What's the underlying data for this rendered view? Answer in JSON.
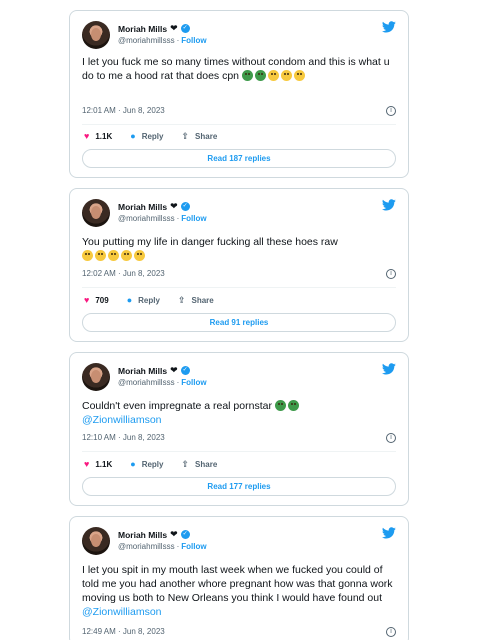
{
  "account": {
    "name": "Moriah Mills",
    "name_emoji": "❤",
    "handle": "@moriahmillsss",
    "follow_label": "Follow",
    "dot": "·"
  },
  "icons": {
    "brand": "twitter-bird-icon",
    "verified": "verified-badge-icon",
    "info": "info-icon",
    "like": "heart-icon",
    "reply": "speech-bubble-icon",
    "share": "share-upload-icon"
  },
  "colors": {
    "accent": "#1d9bf0",
    "like": "#f91880",
    "muted": "#536471",
    "border": "#cfd9de"
  },
  "action_labels": {
    "reply": "Reply",
    "share": "Share"
  },
  "tweets": [
    {
      "text_a": "I let you fuck me so many times without condom and this is what u do to me a hood rat that does cpn",
      "time": "12:01 AM · Jun 8, 2023",
      "likes": "1.1K",
      "read_replies": "Read 187 replies"
    },
    {
      "text_a": "You putting my life in danger fucking all these hoes raw",
      "time": "12:02 AM · Jun 8, 2023",
      "likes": "709",
      "read_replies": "Read 91 replies"
    },
    {
      "text_a": "Couldn't even impregnate a real pornstar",
      "mention": "@Zionwilliamson",
      "time": "12:10 AM · Jun 8, 2023",
      "likes": "1.1K",
      "read_replies": "Read 177 replies"
    },
    {
      "text_a": "I let you spit in my mouth last week when we fucked you could of told me you had another whore pregnant how was that gonna work moving us both to New Orleans you think I would have found out",
      "mention": "@Zionwilliamson",
      "time": "12:49 AM · Jun 8, 2023"
    }
  ]
}
